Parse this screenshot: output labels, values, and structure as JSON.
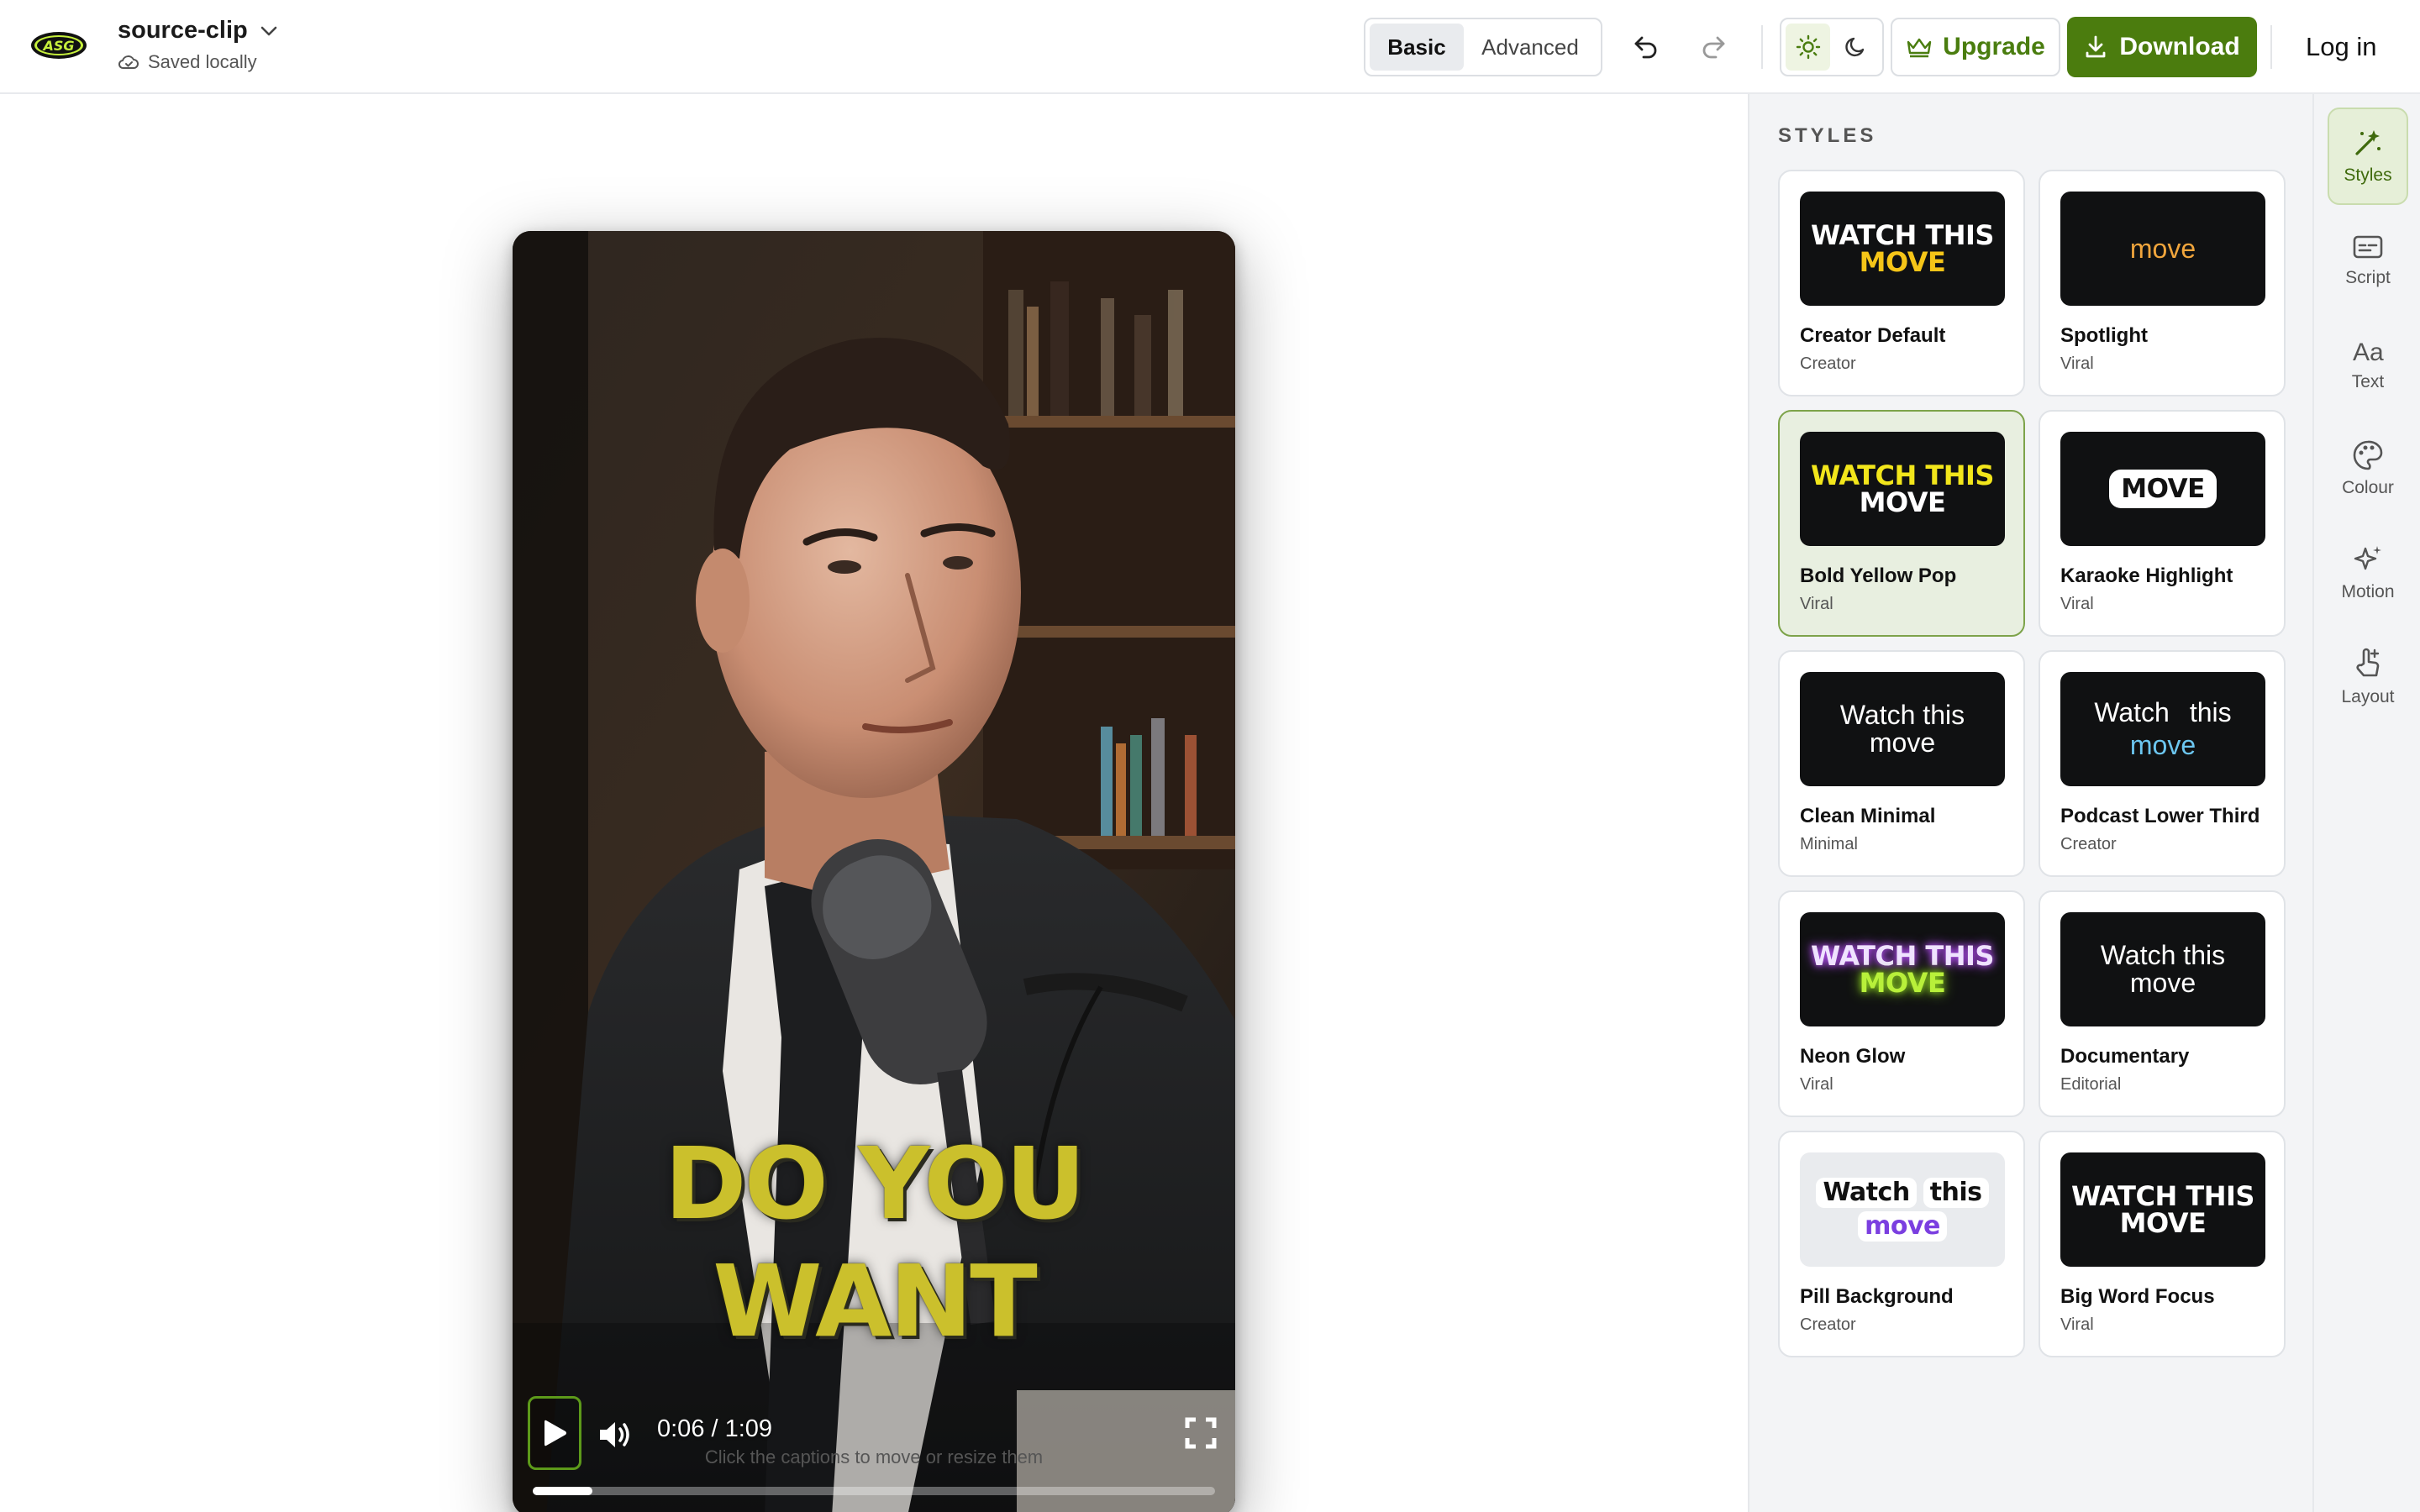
{
  "header": {
    "logo_text": "ASG",
    "project_name": "source-clip",
    "save_status": "Saved locally",
    "mode_tabs": [
      {
        "label": "Basic",
        "active": true
      },
      {
        "label": "Advanced",
        "active": false
      }
    ],
    "upgrade_label": "Upgrade",
    "download_label": "Download",
    "login_label": "Log in",
    "brand_color": "#4b7c0e"
  },
  "player": {
    "caption_lines": [
      "DO YOU",
      "WANT"
    ],
    "caption_color": "#cbc02c",
    "time": "0:06 / 1:09",
    "progress_fraction": 0.087,
    "hint": "Click the captions to move or resize them"
  },
  "styles_panel": {
    "title": "STYLES",
    "cards": [
      {
        "name": "Creator Default",
        "category": "Creator",
        "preview": [
          "WATCH THIS",
          "MOVE"
        ],
        "selected": false
      },
      {
        "name": "Spotlight",
        "category": "Viral",
        "preview": [
          "move"
        ],
        "selected": false
      },
      {
        "name": "Bold Yellow Pop",
        "category": "Viral",
        "preview": [
          "WATCH THIS",
          "MOVE"
        ],
        "selected": true
      },
      {
        "name": "Karaoke Highlight",
        "category": "Viral",
        "preview": [
          "MOVE"
        ],
        "selected": false
      },
      {
        "name": "Clean Minimal",
        "category": "Minimal",
        "preview": [
          "Watch this",
          "move"
        ],
        "selected": false
      },
      {
        "name": "Podcast Lower Third",
        "category": "Creator",
        "preview": [
          "Watch",
          "this",
          "move"
        ],
        "selected": false
      },
      {
        "name": "Neon Glow",
        "category": "Viral",
        "preview": [
          "WATCH THIS",
          "MOVE"
        ],
        "selected": false
      },
      {
        "name": "Documentary",
        "category": "Editorial",
        "preview": [
          "Watch this",
          "move"
        ],
        "selected": false
      },
      {
        "name": "Pill Background",
        "category": "Creator",
        "preview": [
          "Watch",
          "this",
          "move"
        ],
        "selected": false
      },
      {
        "name": "Big Word Focus",
        "category": "Viral",
        "preview": [
          "WATCH THIS",
          "MOVE"
        ],
        "selected": false
      }
    ]
  },
  "rail": {
    "items": [
      {
        "label": "Styles",
        "icon": "magic-wand-icon",
        "active": true
      },
      {
        "label": "Script",
        "icon": "subtitles-icon",
        "active": false
      },
      {
        "label": "Text",
        "icon": "text-aa-icon",
        "active": false
      },
      {
        "label": "Colour",
        "icon": "palette-icon",
        "active": false
      },
      {
        "label": "Motion",
        "icon": "sparkle-icon",
        "active": false
      },
      {
        "label": "Layout",
        "icon": "hand-pointer-icon",
        "active": false
      }
    ]
  }
}
